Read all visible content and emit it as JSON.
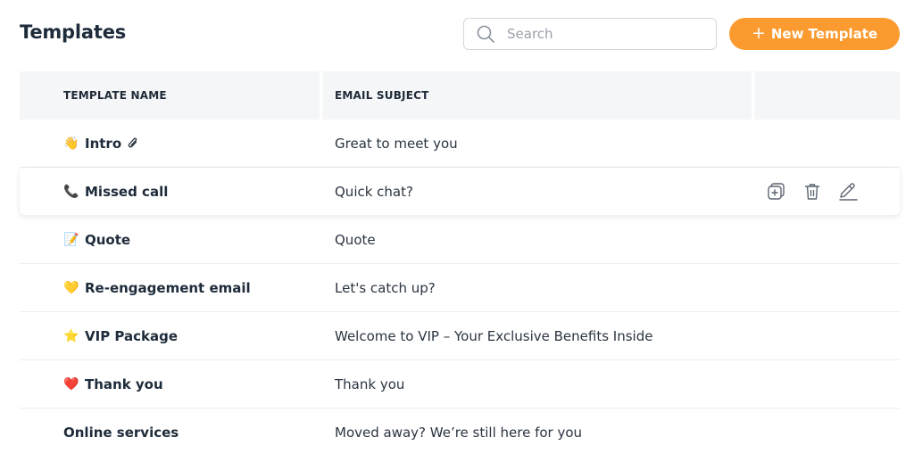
{
  "header": {
    "title": "Templates",
    "search": {
      "placeholder": "Search",
      "value": ""
    },
    "new_button_label": "New Template"
  },
  "table": {
    "columns": {
      "name": "TEMPLATE NAME",
      "subject": "EMAIL SUBJECT"
    },
    "rows": [
      {
        "name": "Intro",
        "subject": "Great to meet you",
        "emoji": "👋",
        "icon": "waving-hand-icon",
        "attachment": true
      },
      {
        "name": "Missed call",
        "subject": "Quick chat?",
        "emoji": "📞",
        "icon": "phone-icon"
      },
      {
        "name": "Quote",
        "subject": "Quote",
        "emoji": "📝",
        "icon": "memo-icon"
      },
      {
        "name": "Re-engagement email",
        "subject": "Let's catch up?",
        "emoji": "💛",
        "icon": "yellow-heart-icon"
      },
      {
        "name": "VIP Package",
        "subject": "Welcome to VIP – Your Exclusive Benefits Inside",
        "emoji": "⭐",
        "icon": "star-icon"
      },
      {
        "name": "Thank you",
        "subject": "Thank you",
        "emoji": "❤️",
        "icon": "red-heart-icon"
      },
      {
        "name": "Online services",
        "subject": "Moved away? We’re still here for you"
      }
    ],
    "hovered_row_actions": [
      "duplicate-icon",
      "trash-icon",
      "edit-icon"
    ]
  },
  "colors": {
    "accent": "#fb9a2f",
    "header_bg": "#f5f6f7",
    "text": "#1d2b3a",
    "icon": "#5b6470"
  }
}
